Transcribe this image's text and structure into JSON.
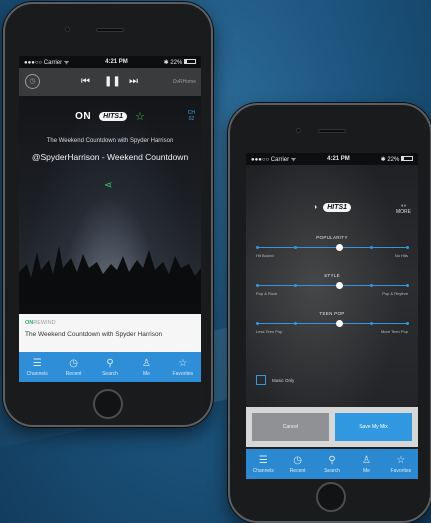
{
  "phone1": {
    "status": {
      "carrier": "●●●○○ Carrier ᯤ",
      "time": "4:21 PM",
      "battery": "✱ 22%"
    },
    "player": {
      "right_label": "DvRHome"
    },
    "hero": {
      "logo_on": "ON",
      "logo_hits": "HITS1",
      "channel": "CH\n02",
      "show": "The Weekend Countdown with Spyder Harrison",
      "title": "@SpyderHarrison - Weekend Countdown"
    },
    "now_playing": {
      "label_prefix": "ON",
      "label_suffix": "REWIND",
      "show": "The Weekend Countdown with Spyder Harrison"
    },
    "tabs": [
      {
        "label": "Channels",
        "icon": "channels-icon"
      },
      {
        "label": "Recent",
        "icon": "recent-icon"
      },
      {
        "label": "Search",
        "icon": "search-icon"
      },
      {
        "label": "Me",
        "icon": "me-icon"
      },
      {
        "label": "Favorites",
        "icon": "favorites-icon"
      }
    ]
  },
  "phone2": {
    "status": {
      "carrier": "●●●○○ Carrier ᯤ",
      "time": "4:21 PM",
      "battery": "✱ 22%"
    },
    "header": {
      "logo_hits": "HITS1",
      "more": "MORE"
    },
    "sliders": [
      {
        "label": "POPULARITY",
        "left": "Hit Bound",
        "right": "No Hits",
        "value": 0.55
      },
      {
        "label": "STYLE",
        "left": "Pop & Rock",
        "right": "Pop & Rhythm",
        "value": 0.55
      },
      {
        "label": "TEEN POP",
        "left": "Less Teen Pop",
        "right": "More Teen Pop",
        "value": 0.55
      }
    ],
    "music_only": "Music Only",
    "buttons": {
      "cancel": "Cancel",
      "save": "Save My Mix"
    },
    "tabs": [
      {
        "label": "Channels",
        "icon": "channels-icon"
      },
      {
        "label": "Recent",
        "icon": "recent-icon"
      },
      {
        "label": "Search",
        "icon": "search-icon"
      },
      {
        "label": "Me",
        "icon": "me-icon"
      },
      {
        "label": "Favorites",
        "icon": "favorites-icon"
      }
    ]
  }
}
